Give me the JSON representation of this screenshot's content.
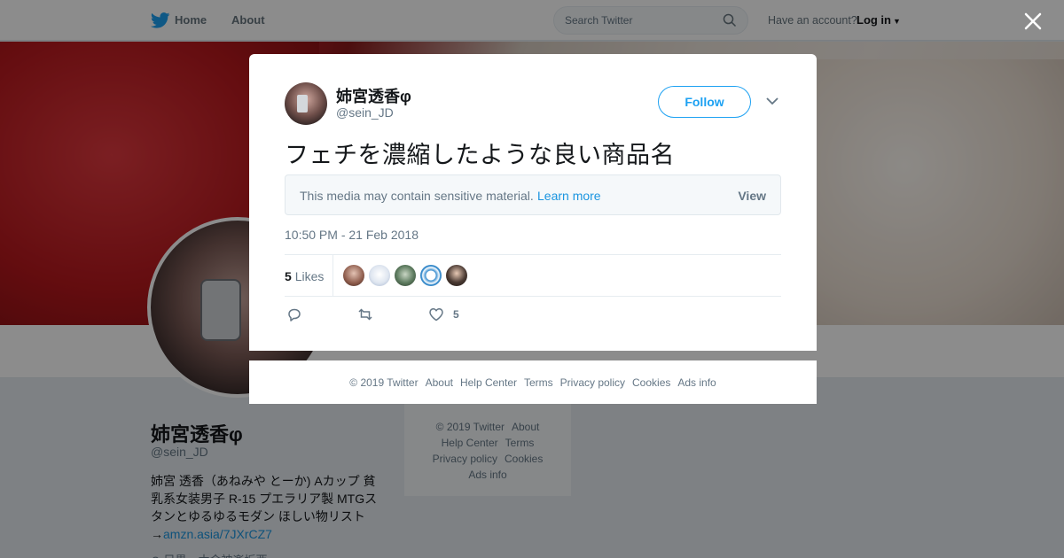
{
  "nav": {
    "home_label": "Home",
    "about_label": "About",
    "search_placeholder": "Search Twitter",
    "have_account": "Have an account?",
    "login_label": "Log in"
  },
  "profile": {
    "name": "姉宮透香φ",
    "handle": "@sein_JD",
    "bio_text": "姉宮 透香（あねみや とーか) Aカップ 貧乳系女装男子 R-15 プエラリア製 MTGスタンとゆるゆるモダン ほしい物リスト→",
    "bio_link": "amzn.asia/7JXrCZ7",
    "location_partial": "⊙ 目黒…木金神楽坂西"
  },
  "side_footer": [
    "© 2019 Twitter",
    "About",
    "Help Center",
    "Terms",
    "Privacy policy",
    "Cookies",
    "Ads info"
  ],
  "tweet": {
    "name": "姉宮透香φ",
    "handle": "@sein_JD",
    "follow_label": "Follow",
    "text": "フェチを濃縮したような良い商品名",
    "sensitive_msg": "This media may contain sensitive material.",
    "learn_more": "Learn more",
    "view_label": "View",
    "timestamp": "10:50 PM - 21 Feb 2018",
    "likes_number": "5",
    "likes_label": "Likes",
    "like_action_count": "5",
    "likers": [
      "#8c5a4a",
      "#dfe6f0",
      "#5c7a5e",
      "#3b8fd0",
      "#4a3a33"
    ]
  },
  "modal_footer": [
    "© 2019 Twitter",
    "About",
    "Help Center",
    "Terms",
    "Privacy policy",
    "Cookies",
    "Ads info"
  ],
  "colors": {
    "accent": "#1da1f2",
    "link": "#1b95e0",
    "muted": "#657786"
  }
}
